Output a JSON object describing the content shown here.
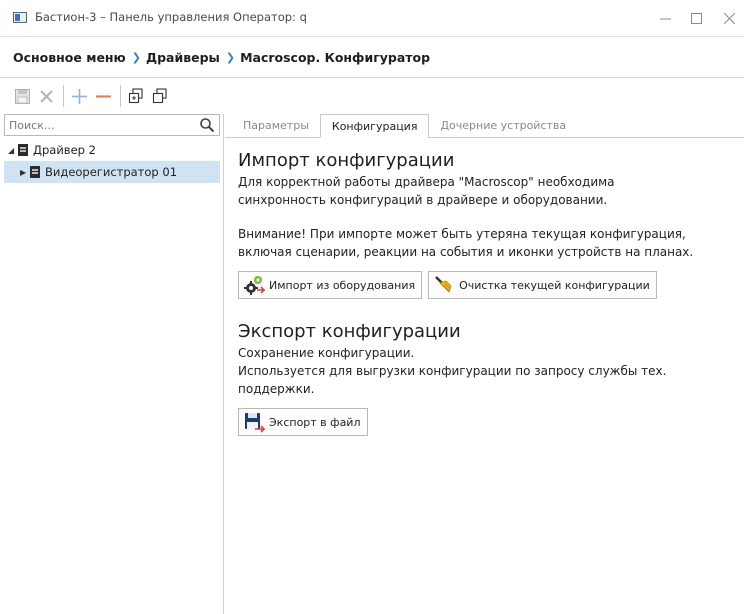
{
  "window": {
    "title": "Бастион-3 – Панель управления Оператор: q"
  },
  "breadcrumb": {
    "items": [
      "Основное меню",
      "Драйверы",
      "Macroscop. Конфигуратор"
    ]
  },
  "sidebar": {
    "search_placeholder": "Поиск...",
    "tree": [
      {
        "label": "Драйвер 2",
        "expanded": true
      },
      {
        "label": "Видеорегистратор 01",
        "expanded": false,
        "selected": true
      }
    ]
  },
  "tabs": [
    {
      "label": "Параметры",
      "active": false
    },
    {
      "label": "Конфигурация",
      "active": true
    },
    {
      "label": "Дочерние устройства",
      "active": false
    }
  ],
  "import": {
    "title": "Импорт конфигурации",
    "desc_line1": "Для корректной работы драйвера \"Macroscop\" необходима",
    "desc_line2": "синхронность конфигураций в драйвере и оборудовании.",
    "warn_line1": "Внимание! При импорте может быть утеряна текущая конфигурация,",
    "warn_line2": "включая сценарии, реакции на события и иконки устройств на планах.",
    "import_button": "Импорт из оборудования",
    "clear_button": "Очистка текущей конфигурации"
  },
  "export": {
    "title": "Экспорт конфигурации",
    "line1": "Сохранение конфигурации.",
    "line2": "Используется для выгрузки конфигурации по запросу службы тех.",
    "line3": "поддержки.",
    "export_button": "Экспорт в файл"
  },
  "colors": {
    "accent": "#3b82c4",
    "selection": "#cfe3f3",
    "add_icon": "#8cb4dc",
    "remove_icon": "#e8804a"
  }
}
